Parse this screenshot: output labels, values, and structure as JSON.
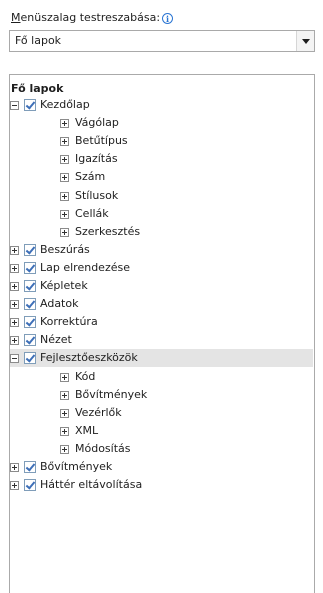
{
  "customize": {
    "label_access": "M",
    "label_rest": "enüszalag testreszabása:",
    "info_icon": "i",
    "selected_value": "Fő lapok"
  },
  "tree": {
    "header": "Fő lapok",
    "items": [
      {
        "label": "Kezdőlap",
        "level": 0,
        "expanded": true,
        "checked": true
      },
      {
        "label": "Vágólap",
        "level": 1
      },
      {
        "label": "Betűtípus",
        "level": 1
      },
      {
        "label": "Igazítás",
        "level": 1
      },
      {
        "label": "Szám",
        "level": 1
      },
      {
        "label": "Stílusok",
        "level": 1
      },
      {
        "label": "Cellák",
        "level": 1
      },
      {
        "label": "Szerkesztés",
        "level": 1
      },
      {
        "label": "Beszúrás",
        "level": 0,
        "expanded": false,
        "checked": true
      },
      {
        "label": "Lap elrendezése",
        "level": 0,
        "expanded": false,
        "checked": true
      },
      {
        "label": "Képletek",
        "level": 0,
        "expanded": false,
        "checked": true
      },
      {
        "label": "Adatok",
        "level": 0,
        "expanded": false,
        "checked": true
      },
      {
        "label": "Korrektúra",
        "level": 0,
        "expanded": false,
        "checked": true
      },
      {
        "label": "Nézet",
        "level": 0,
        "expanded": false,
        "checked": true
      },
      {
        "label": "Fejlesztőeszközök",
        "level": 0,
        "expanded": true,
        "checked": true,
        "selected": true
      },
      {
        "label": "Kód",
        "level": 1
      },
      {
        "label": "Bővítmények",
        "level": 1
      },
      {
        "label": "Vezérlők",
        "level": 1
      },
      {
        "label": "XML",
        "level": 1
      },
      {
        "label": "Módosítás",
        "level": 1
      },
      {
        "label": "Bővítmények",
        "level": 0,
        "expanded": false,
        "checked": true
      },
      {
        "label": "Háttér eltávolítása",
        "level": 0,
        "expanded": false,
        "checked": true
      }
    ]
  }
}
